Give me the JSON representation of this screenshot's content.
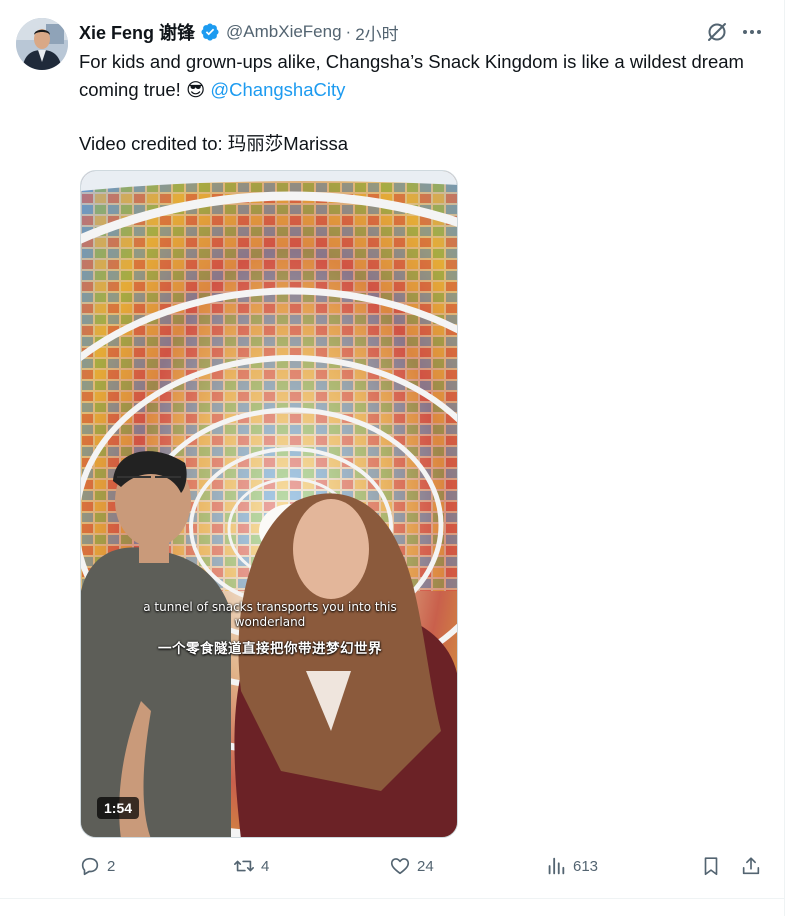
{
  "tweet": {
    "author_name": "Xie Feng 谢锋",
    "handle": "@AmbXieFeng",
    "separator": "·",
    "time": "2小时",
    "text_line": "For kids and grown-ups alike, Changsha’s Snack Kingdom is like a wildest dream coming true! ",
    "emoji": "😎",
    "mention": "@ChangshaCity",
    "credit": "Video credited to: 玛丽莎Marissa"
  },
  "media": {
    "caption_en": "a tunnel of snacks transports you into this wonderland",
    "caption_zh": "一个零食隧道直接把你带进梦幻世界",
    "duration": "1:54"
  },
  "actions": {
    "replies": "2",
    "reposts": "4",
    "likes": "24",
    "views": "613"
  },
  "icons": [
    "avatar",
    "verified-badge-icon",
    "grok-icon",
    "more-icon",
    "reply-icon",
    "repost-icon",
    "like-icon",
    "views-icon",
    "bookmark-icon",
    "share-icon"
  ],
  "colors": {
    "accent": "#1d9bf0",
    "secondary_text": "#536471",
    "text": "#0f1419"
  }
}
